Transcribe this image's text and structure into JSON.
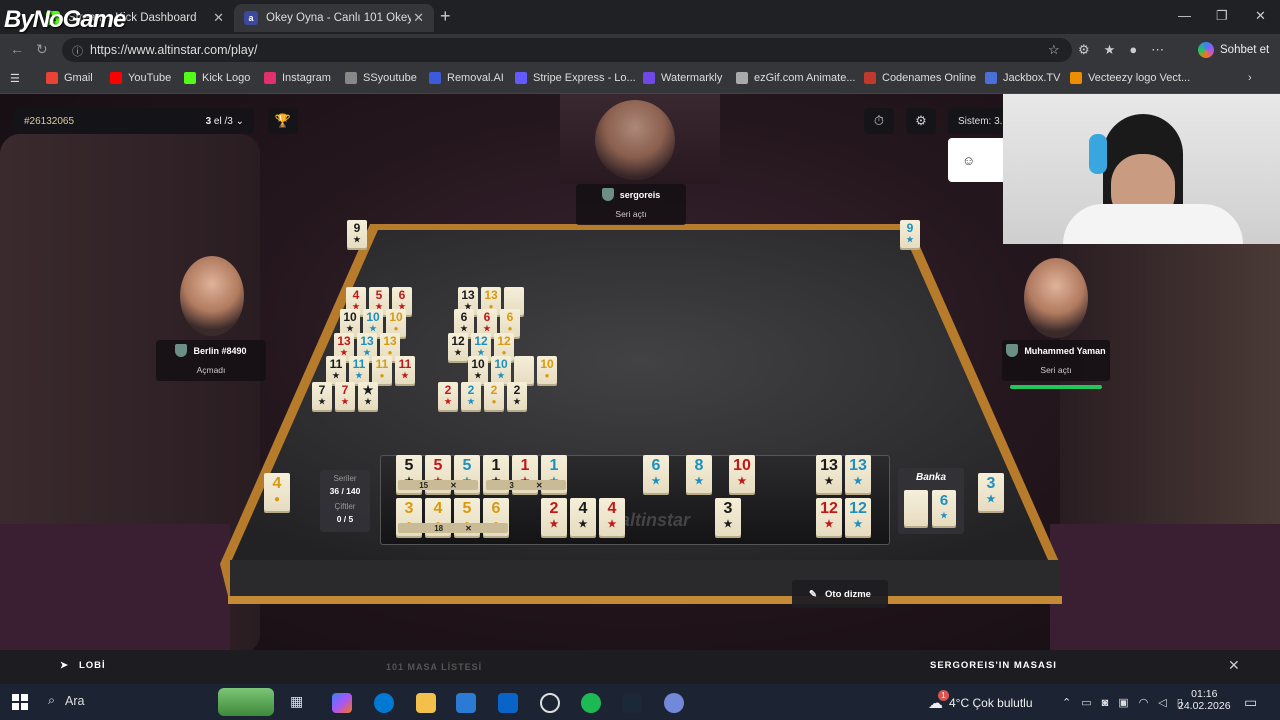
{
  "overlay_logo": "ByNoGame",
  "tabs": [
    {
      "title": "Stream - Kick Dashboard",
      "icon": "kick-icon",
      "color": "#53fc18"
    },
    {
      "title": "Okey Oyna - Canlı 101 Okey ve Dü",
      "icon": "altinstar-icon",
      "color": "#3b4a9e"
    }
  ],
  "address": {
    "url": "https://www.altinstar.com/play/"
  },
  "copilot_label": "Sohbet et",
  "bookmarks": [
    {
      "label": "Gmail",
      "color": "#ea4335"
    },
    {
      "label": "YouTube",
      "color": "#ff0000"
    },
    {
      "label": "Kick Logo",
      "color": "#53fc18"
    },
    {
      "label": "Instagram",
      "color": "#e1306c"
    },
    {
      "label": "SSyoutube",
      "color": "#888888"
    },
    {
      "label": "Removal.AI",
      "color": "#3b5bdb"
    },
    {
      "label": "Stripe Express - Lo...",
      "color": "#635bff"
    },
    {
      "label": "Watermarkly",
      "color": "#7048e8"
    },
    {
      "label": "ezGif.com Animate...",
      "color": "#aaaaaa"
    },
    {
      "label": "Codenames Online",
      "color": "#c0392b"
    },
    {
      "label": "Jackbox.TV",
      "color": "#4a6fd8"
    },
    {
      "label": "Vecteezy logo Vect...",
      "color": "#f08c00"
    }
  ],
  "game": {
    "game_id": "#26132065",
    "round_num": "3",
    "round_suffix": "el /3",
    "sistem": "Sistem: 3.",
    "players": {
      "top": {
        "name": "sergoreis",
        "status": "Seri açtı"
      },
      "left": {
        "name": "Berlin #8490",
        "status": "Açmadı"
      },
      "right": {
        "name": "Muhammed Yaman",
        "status": "Seri açtı"
      }
    },
    "corner_tiles": {
      "top_left": "9",
      "top_right": "9",
      "left_discard": "4",
      "right_discard": "3"
    },
    "table_groups": [
      [
        {
          "n": "4",
          "c": "red"
        },
        {
          "n": "5",
          "c": "red"
        },
        {
          "n": "6",
          "c": "red"
        }
      ],
      [
        {
          "n": "10",
          "c": "black"
        },
        {
          "n": "10",
          "c": "blue"
        },
        {
          "n": "10",
          "c": "yellow"
        }
      ],
      [
        {
          "n": "13",
          "c": "red"
        },
        {
          "n": "13",
          "c": "blue"
        },
        {
          "n": "13",
          "c": "yellow"
        }
      ],
      [
        {
          "n": "11",
          "c": "black"
        },
        {
          "n": "11",
          "c": "blue"
        },
        {
          "n": "11",
          "c": "yellow"
        },
        {
          "n": "11",
          "c": "red"
        }
      ],
      [
        {
          "n": "7",
          "c": "black"
        },
        {
          "n": "7",
          "c": "red"
        },
        {
          "n": "★",
          "c": "black"
        }
      ],
      [
        {
          "n": "13",
          "c": "black"
        },
        {
          "n": "13",
          "c": "yellow"
        },
        {
          "n": "",
          "c": "black"
        }
      ],
      [
        {
          "n": "6",
          "c": "black"
        },
        {
          "n": "6",
          "c": "red"
        },
        {
          "n": "6",
          "c": "yellow"
        }
      ],
      [
        {
          "n": "12",
          "c": "black"
        },
        {
          "n": "12",
          "c": "blue"
        },
        {
          "n": "12",
          "c": "yellow"
        }
      ],
      [
        {
          "n": "10",
          "c": "black"
        },
        {
          "n": "10",
          "c": "blue"
        },
        {
          "n": "",
          "c": "black"
        },
        {
          "n": "10",
          "c": "yellow"
        }
      ],
      [
        {
          "n": "2",
          "c": "red"
        },
        {
          "n": "2",
          "c": "blue"
        },
        {
          "n": "2",
          "c": "yellow"
        },
        {
          "n": "2",
          "c": "black"
        }
      ]
    ],
    "rack_top": [
      {
        "n": "5",
        "c": "black"
      },
      {
        "n": "5",
        "c": "red"
      },
      {
        "n": "5",
        "c": "blue"
      },
      {
        "n": "1",
        "c": "black"
      },
      {
        "n": "1",
        "c": "red"
      },
      {
        "n": "1",
        "c": "blue"
      },
      {
        "n": "6",
        "c": "blue"
      },
      {
        "n": "8",
        "c": "blue"
      },
      {
        "n": "10",
        "c": "red"
      },
      {
        "n": "13",
        "c": "black"
      },
      {
        "n": "13",
        "c": "blue"
      }
    ],
    "rack_top_sums": [
      "15",
      "3"
    ],
    "rack_bottom": [
      {
        "n": "3",
        "c": "yellow"
      },
      {
        "n": "4",
        "c": "yellow"
      },
      {
        "n": "5",
        "c": "yellow"
      },
      {
        "n": "6",
        "c": "yellow"
      },
      {
        "n": "2",
        "c": "red"
      },
      {
        "n": "4",
        "c": "black"
      },
      {
        "n": "4",
        "c": "red"
      },
      {
        "n": "3",
        "c": "black"
      },
      {
        "n": "12",
        "c": "red"
      },
      {
        "n": "12",
        "c": "blue"
      }
    ],
    "rack_bottom_sums": [
      "18"
    ],
    "rack_brand": "altinstar",
    "stats": {
      "series_label": "Seriler",
      "series_value": "36 / 140",
      "pairs_label": "Çiftler",
      "pairs_value": "0 / 5"
    },
    "bank": {
      "label": "Banka",
      "tile": "6"
    },
    "auto_sort": "Oto dizme",
    "bottom": {
      "lobby": "LOBİ",
      "table_list": "101 MASA LİSTESİ",
      "table_name": "SERGOREIS'IN MASASI"
    }
  },
  "taskbar": {
    "search": "Ara",
    "weather": "4°C  Çok bulutlu",
    "weather_badge": "1",
    "time": "01:16",
    "date": "24.02.2026"
  }
}
